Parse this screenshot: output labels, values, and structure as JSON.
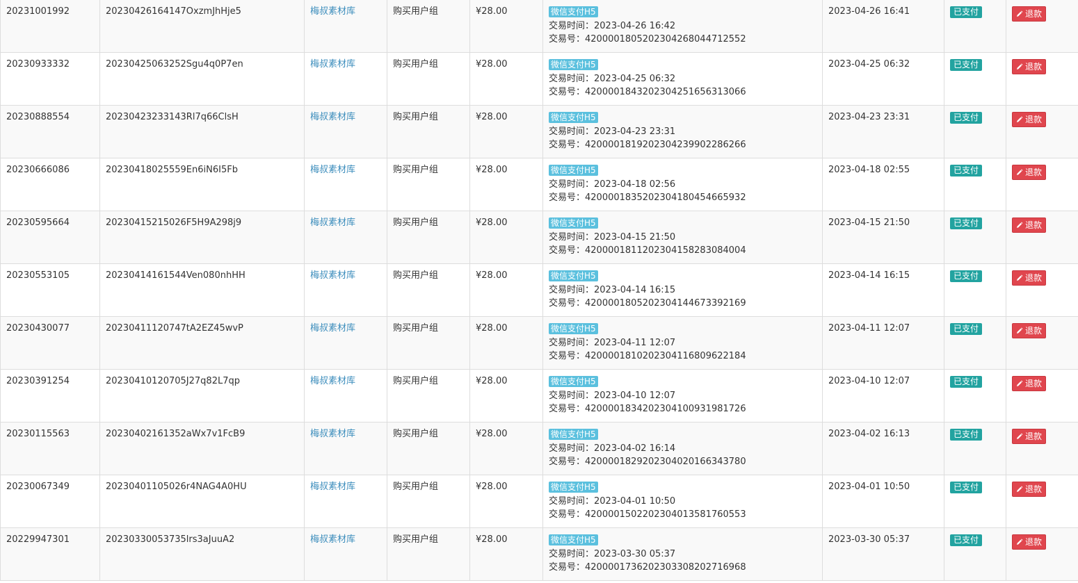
{
  "labels": {
    "trade_time": "交易时间：",
    "trade_no": "交易号：",
    "refund": "退款"
  },
  "colors": {
    "link": "#3c8dbc",
    "pay_method_badge": "#5bc0de",
    "status_badge": "#22a3a0",
    "refund_button": "#e0464e",
    "row_stripe": "#f9f9f9"
  },
  "rows": [
    {
      "id": "20231001992",
      "order_no": "20230426164147OxzmJhHje5",
      "site": "梅叔素材库",
      "product": "购买用户组",
      "amount": "¥28.00",
      "pay_method": "微信支付H5",
      "trade_time": "2023-04-26 16:42",
      "trade_no": "4200001805202304268044712552",
      "created": "2023-04-26 16:41",
      "status": "已支付"
    },
    {
      "id": "20230933332",
      "order_no": "20230425063252Sgu4q0P7en",
      "site": "梅叔素材库",
      "product": "购买用户组",
      "amount": "¥28.00",
      "pay_method": "微信支付H5",
      "trade_time": "2023-04-25 06:32",
      "trade_no": "4200001843202304251656313066",
      "created": "2023-04-25 06:32",
      "status": "已支付"
    },
    {
      "id": "20230888554",
      "order_no": "20230423233143Rl7q66ClsH",
      "site": "梅叔素材库",
      "product": "购买用户组",
      "amount": "¥28.00",
      "pay_method": "微信支付H5",
      "trade_time": "2023-04-23 23:31",
      "trade_no": "4200001819202304239902286266",
      "created": "2023-04-23 23:31",
      "status": "已支付"
    },
    {
      "id": "20230666086",
      "order_no": "20230418025559En6iN6I5Fb",
      "site": "梅叔素材库",
      "product": "购买用户组",
      "amount": "¥28.00",
      "pay_method": "微信支付H5",
      "trade_time": "2023-04-18 02:56",
      "trade_no": "4200001835202304180454665932",
      "created": "2023-04-18 02:55",
      "status": "已支付"
    },
    {
      "id": "20230595664",
      "order_no": "20230415215026F5H9A298j9",
      "site": "梅叔素材库",
      "product": "购买用户组",
      "amount": "¥28.00",
      "pay_method": "微信支付H5",
      "trade_time": "2023-04-15 21:50",
      "trade_no": "4200001811202304158283084004",
      "created": "2023-04-15 21:50",
      "status": "已支付"
    },
    {
      "id": "20230553105",
      "order_no": "20230414161544Ven080nhHH",
      "site": "梅叔素材库",
      "product": "购买用户组",
      "amount": "¥28.00",
      "pay_method": "微信支付H5",
      "trade_time": "2023-04-14 16:15",
      "trade_no": "4200001805202304144673392169",
      "created": "2023-04-14 16:15",
      "status": "已支付"
    },
    {
      "id": "20230430077",
      "order_no": "20230411120747tA2EZ45wvP",
      "site": "梅叔素材库",
      "product": "购买用户组",
      "amount": "¥28.00",
      "pay_method": "微信支付H5",
      "trade_time": "2023-04-11 12:07",
      "trade_no": "4200001810202304116809622184",
      "created": "2023-04-11 12:07",
      "status": "已支付"
    },
    {
      "id": "20230391254",
      "order_no": "20230410120705J27q82L7qp",
      "site": "梅叔素材库",
      "product": "购买用户组",
      "amount": "¥28.00",
      "pay_method": "微信支付H5",
      "trade_time": "2023-04-10 12:07",
      "trade_no": "4200001834202304100931981726",
      "created": "2023-04-10 12:07",
      "status": "已支付"
    },
    {
      "id": "20230115563",
      "order_no": "20230402161352aWx7v1FcB9",
      "site": "梅叔素材库",
      "product": "购买用户组",
      "amount": "¥28.00",
      "pay_method": "微信支付H5",
      "trade_time": "2023-04-02 16:14",
      "trade_no": "4200001829202304020166343780",
      "created": "2023-04-02 16:13",
      "status": "已支付"
    },
    {
      "id": "20230067349",
      "order_no": "20230401105026r4NAG4A0HU",
      "site": "梅叔素材库",
      "product": "购买用户组",
      "amount": "¥28.00",
      "pay_method": "微信支付H5",
      "trade_time": "2023-04-01 10:50",
      "trade_no": "4200001502202304013581760553",
      "created": "2023-04-01 10:50",
      "status": "已支付"
    },
    {
      "id": "20229947301",
      "order_no": "20230330053735lrs3aJuuA2",
      "site": "梅叔素材库",
      "product": "购买用户组",
      "amount": "¥28.00",
      "pay_method": "微信支付H5",
      "trade_time": "2023-03-30 05:37",
      "trade_no": "4200001736202303308202716968",
      "created": "2023-03-30 05:37",
      "status": "已支付"
    }
  ]
}
